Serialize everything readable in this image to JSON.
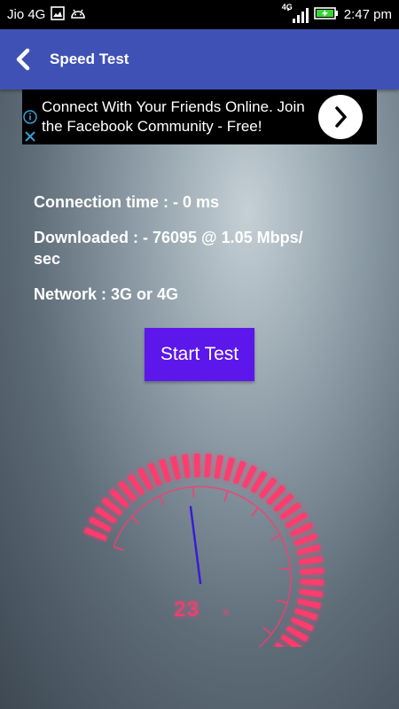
{
  "status_bar": {
    "carrier": "Jio 4G",
    "network_badge": "4G",
    "time": "2:47 pm",
    "icons": [
      "image-icon",
      "android-icon",
      "signal-icon",
      "battery-charging-icon"
    ]
  },
  "app_bar": {
    "title": "Speed Test",
    "back_icon": "chevron-left-icon",
    "color": "#3f51b5"
  },
  "ad": {
    "text": "Connect With Your Friends Online. Join the Facebook Community - Free!",
    "icons": [
      "info-icon",
      "close-icon",
      "chevron-right-icon"
    ]
  },
  "stats": {
    "connection_time": "Connection time  : -    0 ms",
    "downloaded_line1": "Downloaded  : -    76095 @  1.05 Mbps/",
    "downloaded_line2": "sec",
    "network": "Network : 3G or 4G"
  },
  "start_button": {
    "label": "Start Test",
    "color": "#5c17ea"
  },
  "gauge": {
    "value": 23,
    "unit": "%",
    "max": 100,
    "accent_color": "#ff3a6e",
    "needle_color": "#3a1bd6"
  }
}
